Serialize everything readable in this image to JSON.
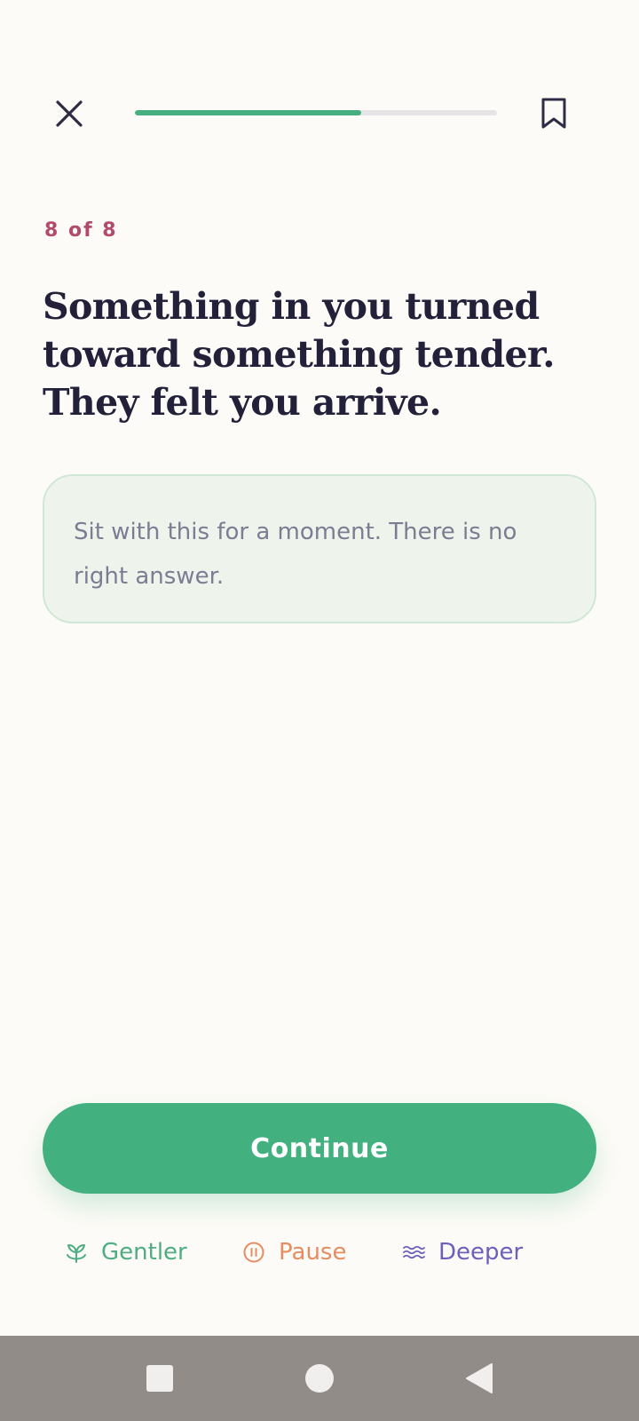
{
  "status_bar": {
    "left_text": "",
    "right_text": ""
  },
  "progress": {
    "value": 0.625
  },
  "step": {
    "label": "8 of 8"
  },
  "prompt": {
    "lines": [
      "Something in you turned",
      "toward something tender.",
      "They felt you arrive."
    ]
  },
  "reflect_card": {
    "text": "Sit with this for a moment. There is no right answer."
  },
  "actions": {
    "continue_label": "Continue"
  },
  "modes": {
    "gentler": {
      "label": "Gentler",
      "icon": "sprout-icon",
      "color": "#4EAE82"
    },
    "pause": {
      "label": "Pause",
      "icon": "pause-circle-icon",
      "color": "#E58D60"
    },
    "deeper": {
      "label": "Deeper",
      "icon": "waves-icon",
      "color": "#6D5FBC"
    }
  },
  "colors": {
    "background": "#FDFBF7",
    "accent": "#42B07F",
    "step_counter": "#B24A6E",
    "title": "#23213A",
    "nav_bar": "#928C88"
  },
  "icons": {
    "close": "close-icon",
    "bookmark": "bookmark-icon",
    "nav_recents": "square-icon",
    "nav_home": "circle-icon",
    "nav_back": "triangle-back-icon"
  }
}
